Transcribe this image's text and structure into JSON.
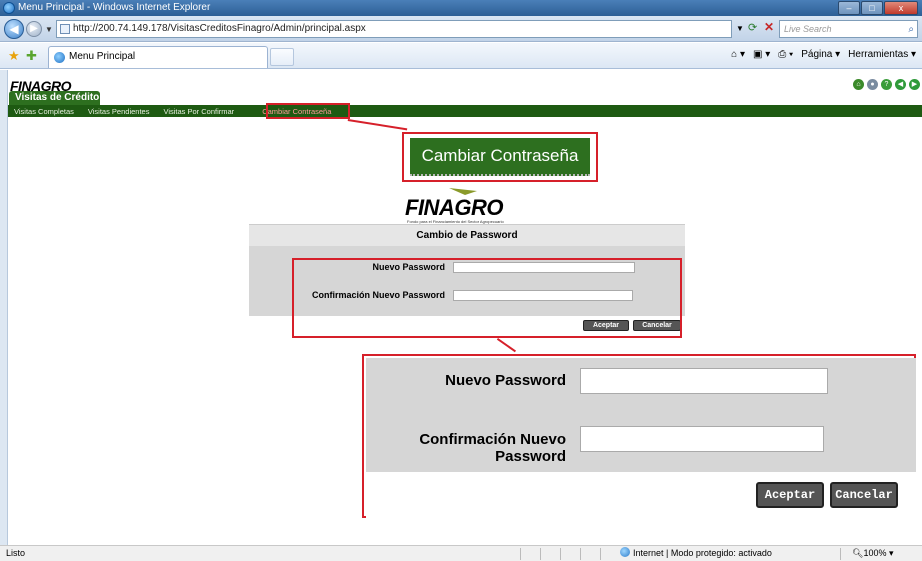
{
  "window": {
    "title": "Menu Principal - Windows Internet Explorer",
    "controls": [
      "–",
      "□",
      "x"
    ]
  },
  "address_bar": {
    "url": "http://200.74.149.178/VisitasCreditosFinagro/Admin/principal.aspx",
    "search_placeholder": "Live Search"
  },
  "command_bar": {
    "tab_title": "Menu Principal",
    "tools": [
      "Página ▾",
      "Herramientas ▾"
    ]
  },
  "app": {
    "logo": "FINAGRO",
    "menu_title": "Visitas de Crédito",
    "menu_items": [
      "Visitas Completas",
      "Visitas Pendientes",
      "Visitas Por Confirmar",
      "Cambiar Contraseña"
    ],
    "zoom_menu_label": "Cambiar Contraseña",
    "center_logo": {
      "text": "FINAGRO",
      "subtitle": "Fondo para el Financiamiento del Sector Agropecuario"
    }
  },
  "form": {
    "title": "Cambio de Password",
    "new_password_label": "Nuevo Password",
    "confirm_password_label": "Confirmación Nuevo Password",
    "accept_label": "Aceptar",
    "cancel_label": "Cancelar"
  },
  "status_bar": {
    "status": "Listo",
    "zone": "Internet | Modo protegido: activado",
    "zoom": "100%"
  },
  "colors": {
    "menu_green": "#2d6f1f",
    "menu_dark_green": "#1e5a12",
    "highlight_red": "#d6202a",
    "form_gray": "#d6d6d6"
  }
}
